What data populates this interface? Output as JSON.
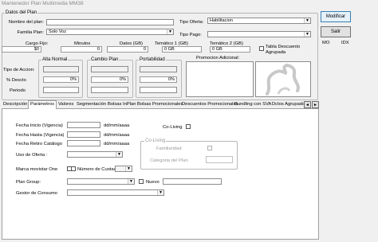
{
  "window_title": "Mantenedor Plan Multimedia MM38",
  "datos_plan": {
    "group_label": "Datos del Plan",
    "nombre_label": "Nombre del plan:",
    "nombre_value": "",
    "familia_label": "Familia Plan:",
    "familia_value": "Solo Voz",
    "tipo_oferta_label": "Tipo Oferta:",
    "tipo_oferta_value": "Habilitacion",
    "tipo_pago_label": "Tipo Pago:",
    "tipo_pago_value": "",
    "cargo_fijo_label": "Cargo Fijo:",
    "cargo_fijo_value": "$0",
    "minutos_label": "Minutos",
    "minutos_value": "0",
    "datos_label": "Datos (GB)",
    "datos_value": "0",
    "tematico1_label": "Temático 1 (GB)",
    "tematico1_value": "0 GB",
    "tematico2_label": "Temático 2 (GB)",
    "tematico2_value": "0 GB",
    "tabla_descuento_label": "Tabla Descuento Agrupada",
    "alta_normal_label": "Alta Normal",
    "cambio_plan_label": "Cambio Plan",
    "portabilidad_label": "Portabilidad",
    "promocion_label": "Promocion Adicional:",
    "tipo_accion_label": "Tipo de Accion:",
    "pct_descto_label": "% Descto",
    "periodo_label": "Periodo",
    "pct_alta": "0%",
    "pct_cambio": "0%",
    "pct_porta": "0%"
  },
  "buttons": {
    "modificar": "Modificar",
    "salir": "Salir"
  },
  "side_labels": {
    "mo": "MO",
    "idx": "IDX"
  },
  "tabs": [
    "Descripción",
    "Parámetros",
    "Valores",
    "Segmentación",
    "Bolsas InPlan",
    "Bolsas Promocionales",
    "Descuentos Promocionales",
    "Bundling con SVA",
    "Dctos Agrupado"
  ],
  "tab_scroll_left": "◄",
  "tab_scroll_right": "►",
  "parametros": {
    "fecha_inicio_label": "Fecha Inicio (Vigencia)",
    "fecha_hasta_label": "Fecha Hasta (Vigencia)",
    "fecha_retiro_label": "Fecha Retiro Catálogo",
    "date_format": "dd/mm/aaaa",
    "uso_oferta_label": "Uso de Oferta :",
    "marca_movistar_label": "Marca movistar One",
    "numero_cuotas_label": "Número de Cuotas",
    "plan_group_label": "Plan Group:",
    "nuevo_label": "Nuevo",
    "gestor_consumo_label": "Gestor de Consumo",
    "co_living_label": "Co-Living",
    "co_living_group_label": "Co-Living",
    "familiaridad_label": "Familiaridad",
    "categoria_label": "Categoria del Plan"
  }
}
